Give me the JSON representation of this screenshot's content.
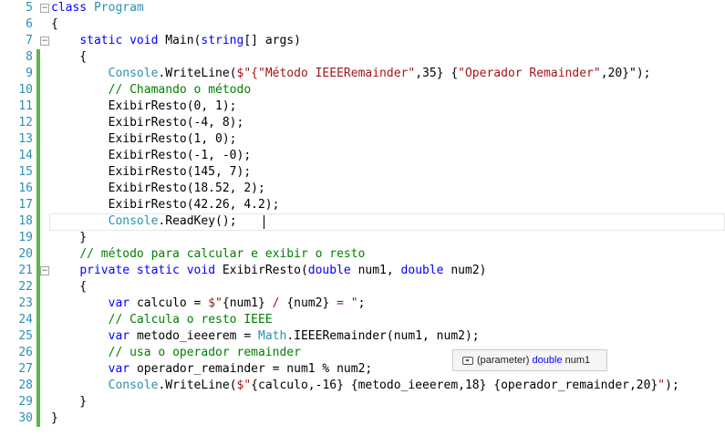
{
  "editor": {
    "lines": [
      {
        "n": "5",
        "tokens": [
          [
            "kw",
            "class "
          ],
          [
            "cls",
            "Program"
          ]
        ]
      },
      {
        "n": "6",
        "tokens": [
          [
            "",
            "{"
          ]
        ]
      },
      {
        "n": "7",
        "tokens": [
          [
            "",
            "    "
          ],
          [
            "kw",
            "static void "
          ],
          [
            "",
            "Main("
          ],
          [
            "kw",
            "string"
          ],
          [
            "",
            "[] args)"
          ]
        ]
      },
      {
        "n": "8",
        "tokens": [
          [
            "",
            "    {"
          ]
        ]
      },
      {
        "n": "9",
        "tokens": [
          [
            "",
            "        "
          ],
          [
            "cls",
            "Console"
          ],
          [
            "",
            ".WriteLine("
          ],
          [
            "str",
            "$\"{\"Método IEEERemainder\""
          ],
          [
            "",
            ",35} {"
          ],
          [
            "str",
            "\"Operador Remainder\""
          ],
          [
            "",
            ",20}\");"
          ]
        ]
      },
      {
        "n": "10",
        "tokens": [
          [
            "",
            "        "
          ],
          [
            "com",
            "// Chamando o método"
          ]
        ]
      },
      {
        "n": "11",
        "tokens": [
          [
            "",
            "        ExibirResto(0, 1);"
          ]
        ]
      },
      {
        "n": "12",
        "tokens": [
          [
            "",
            "        ExibirResto(-4, 8);"
          ]
        ]
      },
      {
        "n": "13",
        "tokens": [
          [
            "",
            "        ExibirResto(1, 0);"
          ]
        ]
      },
      {
        "n": "14",
        "tokens": [
          [
            "",
            "        ExibirResto(-1, -0);"
          ]
        ]
      },
      {
        "n": "15",
        "tokens": [
          [
            "",
            "        ExibirResto(145, 7);"
          ]
        ]
      },
      {
        "n": "16",
        "tokens": [
          [
            "",
            "        ExibirResto(18.52, 2);"
          ]
        ]
      },
      {
        "n": "17",
        "tokens": [
          [
            "",
            "        ExibirResto(42.26, 4.2);"
          ]
        ]
      },
      {
        "n": "18",
        "tokens": [
          [
            "",
            "        "
          ],
          [
            "cls",
            "Console"
          ],
          [
            "",
            ".ReadKey();"
          ]
        ]
      },
      {
        "n": "19",
        "tokens": [
          [
            "",
            "    }"
          ]
        ]
      },
      {
        "n": "20",
        "tokens": [
          [
            "",
            "    "
          ],
          [
            "com",
            "// método para calcular e exibir o resto"
          ]
        ]
      },
      {
        "n": "21",
        "tokens": [
          [
            "",
            "    "
          ],
          [
            "kw",
            "private static void "
          ],
          [
            "",
            "ExibirResto("
          ],
          [
            "kw",
            "double "
          ],
          [
            "",
            "num1, "
          ],
          [
            "kw",
            "double "
          ],
          [
            "",
            "num2)"
          ]
        ]
      },
      {
        "n": "22",
        "tokens": [
          [
            "",
            "    {"
          ]
        ]
      },
      {
        "n": "23",
        "tokens": [
          [
            "",
            "        "
          ],
          [
            "kw",
            "var "
          ],
          [
            "",
            "calculo = "
          ],
          [
            "str",
            "$\""
          ],
          [
            "",
            "{num1}"
          ],
          [
            "str",
            " / "
          ],
          [
            "",
            "{num2}"
          ],
          [
            "str",
            " = \""
          ],
          [
            "",
            ";"
          ]
        ]
      },
      {
        "n": "24",
        "tokens": [
          [
            "",
            "        "
          ],
          [
            "com",
            "// Calcula o resto IEEE"
          ]
        ]
      },
      {
        "n": "25",
        "tokens": [
          [
            "",
            "        "
          ],
          [
            "kw",
            "var "
          ],
          [
            "",
            "metodo_ieeerem = "
          ],
          [
            "cls",
            "Math"
          ],
          [
            "",
            ".IEEERemainder(num1, num2);"
          ]
        ]
      },
      {
        "n": "26",
        "tokens": [
          [
            "",
            "        "
          ],
          [
            "com",
            "// usa o operador remainder"
          ]
        ]
      },
      {
        "n": "27",
        "tokens": [
          [
            "",
            "        "
          ],
          [
            "kw",
            "var "
          ],
          [
            "",
            "operador_remainder = num1 % num2;"
          ]
        ]
      },
      {
        "n": "28",
        "tokens": [
          [
            "",
            "        "
          ],
          [
            "cls",
            "Console"
          ],
          [
            "",
            ".WriteLine("
          ],
          [
            "str",
            "$\""
          ],
          [
            "",
            "{calculo,-16} {metodo_ieeerem,18} {operador_remainder,20}"
          ],
          [
            "str",
            "\""
          ],
          [
            "",
            ");"
          ]
        ]
      },
      {
        "n": "29",
        "tokens": [
          [
            "",
            "    }"
          ]
        ]
      },
      {
        "n": "30",
        "tokens": [
          [
            "",
            "}"
          ]
        ]
      }
    ]
  },
  "tooltip": {
    "kind": "(parameter)",
    "type": "double",
    "name": "num1"
  }
}
